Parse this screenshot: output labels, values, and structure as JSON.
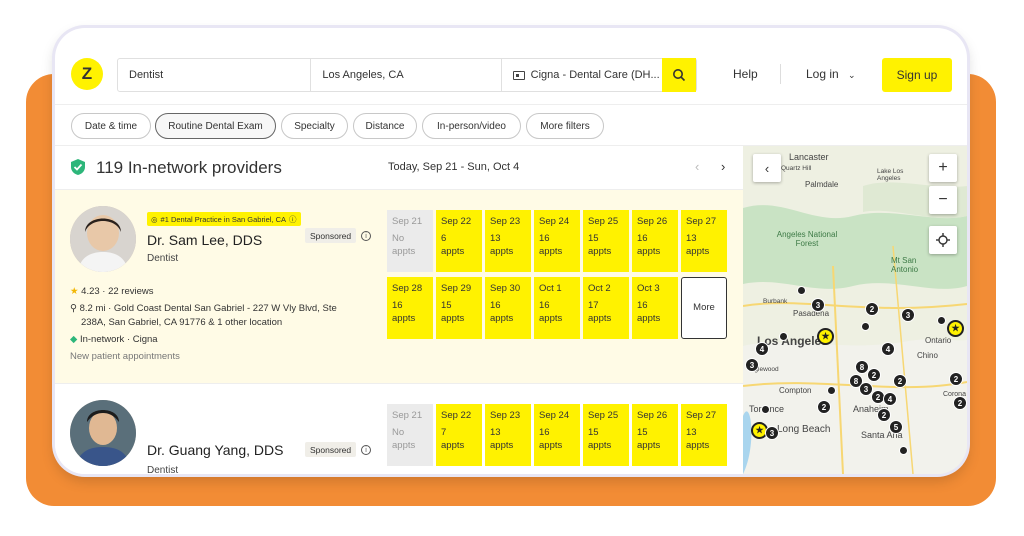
{
  "header": {
    "search_specialty": "Dentist",
    "search_location": "Los Angeles, CA",
    "search_insurance": "Cigna - Dental Care (DH...",
    "help": "Help",
    "login": "Log in",
    "signup": "Sign up"
  },
  "filters": [
    "Date & time",
    "Routine Dental Exam",
    "Specialty",
    "Distance",
    "In-person/video",
    "More filters"
  ],
  "results": {
    "count_label": "119 In-network providers",
    "date_range": "Today, Sep 21 - Sun, Oct 4"
  },
  "providers": [
    {
      "badge": "#1 Dental Practice in San Gabriel, CA",
      "name": "Dr. Sam Lee, DDS",
      "specialty": "Dentist",
      "sponsored": "Sponsored",
      "rating": "4.23 · 22 reviews",
      "address": "8.2 mi · Gold Coast Dental San Gabriel - 227 W Vly Blvd, Ste",
      "address2": "238A, San Gabriel, CA 91776 & 1 other location",
      "network": "In-network · Cigna",
      "appointments_note": "New patient appointments",
      "slots_row1": [
        {
          "date": "Sep 21",
          "count": "No",
          "unit": "appts"
        },
        {
          "date": "Sep 22",
          "count": "6",
          "unit": "appts"
        },
        {
          "date": "Sep 23",
          "count": "13",
          "unit": "appts"
        },
        {
          "date": "Sep 24",
          "count": "16",
          "unit": "appts"
        },
        {
          "date": "Sep 25",
          "count": "15",
          "unit": "appts"
        },
        {
          "date": "Sep 26",
          "count": "16",
          "unit": "appts"
        },
        {
          "date": "Sep 27",
          "count": "13",
          "unit": "appts"
        }
      ],
      "slots_row2": [
        {
          "date": "Sep 28",
          "count": "16",
          "unit": "appts"
        },
        {
          "date": "Sep 29",
          "count": "15",
          "unit": "appts"
        },
        {
          "date": "Sep 30",
          "count": "16",
          "unit": "appts"
        },
        {
          "date": "Oct 1",
          "count": "16",
          "unit": "appts"
        },
        {
          "date": "Oct 2",
          "count": "17",
          "unit": "appts"
        },
        {
          "date": "Oct 3",
          "count": "16",
          "unit": "appts"
        }
      ],
      "more_label": "More"
    },
    {
      "name": "Dr. Guang Yang, DDS",
      "specialty": "Dentist",
      "sponsored": "Sponsored",
      "slots_row1": [
        {
          "date": "Sep 21",
          "count": "No",
          "unit": "appts"
        },
        {
          "date": "Sep 22",
          "count": "7",
          "unit": "appts"
        },
        {
          "date": "Sep 23",
          "count": "13",
          "unit": "appts"
        },
        {
          "date": "Sep 24",
          "count": "16",
          "unit": "appts"
        },
        {
          "date": "Sep 25",
          "count": "15",
          "unit": "appts"
        },
        {
          "date": "Sep 26",
          "count": "15",
          "unit": "appts"
        },
        {
          "date": "Sep 27",
          "count": "13",
          "unit": "appts"
        }
      ]
    }
  ],
  "map": {
    "labels": [
      "Lancaster",
      "Quartz Hill",
      "Palmdale",
      "Lake Los Angeles",
      "Angeles National Forest",
      "Mt San Antonio",
      "Burbank",
      "Pasadena",
      "Los Angeles",
      "Ontario",
      "Chino",
      "Inglewood",
      "Compton",
      "Torrance",
      "Anaheim",
      "Long Beach",
      "Santa Ana",
      "Corona"
    ]
  }
}
